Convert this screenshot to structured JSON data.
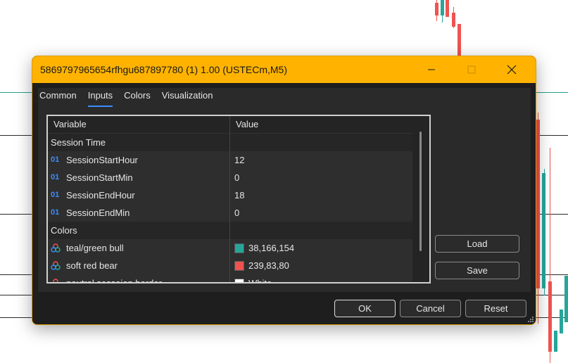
{
  "window": {
    "title": "5869797965654rfhgu687897780 (1) 1.00 (USTECm,M5)",
    "minimize_icon": "minimize-icon",
    "maximize_icon": "maximize-icon",
    "close_icon": "close-icon"
  },
  "tabs": [
    {
      "label": "Common"
    },
    {
      "label": "Inputs",
      "active": true
    },
    {
      "label": "Colors"
    },
    {
      "label": "Visualization"
    }
  ],
  "grid": {
    "header_variable": "Variable",
    "header_value": "Value",
    "rows": [
      {
        "type": "group",
        "variable": "Session Time",
        "value": ""
      },
      {
        "type": "int",
        "icon": "01",
        "variable": "SessionStartHour",
        "value": "12"
      },
      {
        "type": "int",
        "icon": "01",
        "variable": "SessionStartMin",
        "value": "0"
      },
      {
        "type": "int",
        "icon": "01",
        "variable": "SessionEndHour",
        "value": "18"
      },
      {
        "type": "int",
        "icon": "01",
        "variable": "SessionEndMin",
        "value": "0"
      },
      {
        "type": "group",
        "variable": "Colors",
        "value": ""
      },
      {
        "type": "color",
        "variable": "teal/green bull",
        "value": "38,166,154",
        "swatch": "#26a69a"
      },
      {
        "type": "color",
        "variable": "soft red bear",
        "value": "239,83,80",
        "swatch": "#ef5350"
      },
      {
        "type": "color",
        "variable": "neutral sessoion border",
        "value": "White",
        "swatch": "#ffffff"
      }
    ]
  },
  "side_buttons": {
    "load": "Load",
    "save": "Save"
  },
  "footer": {
    "ok": "OK",
    "cancel": "Cancel",
    "reset": "Reset"
  },
  "colors": {
    "titlebar": "#ffb300",
    "accent": "#3b8cff",
    "bull": "#26a69a",
    "bear": "#ef5350"
  }
}
